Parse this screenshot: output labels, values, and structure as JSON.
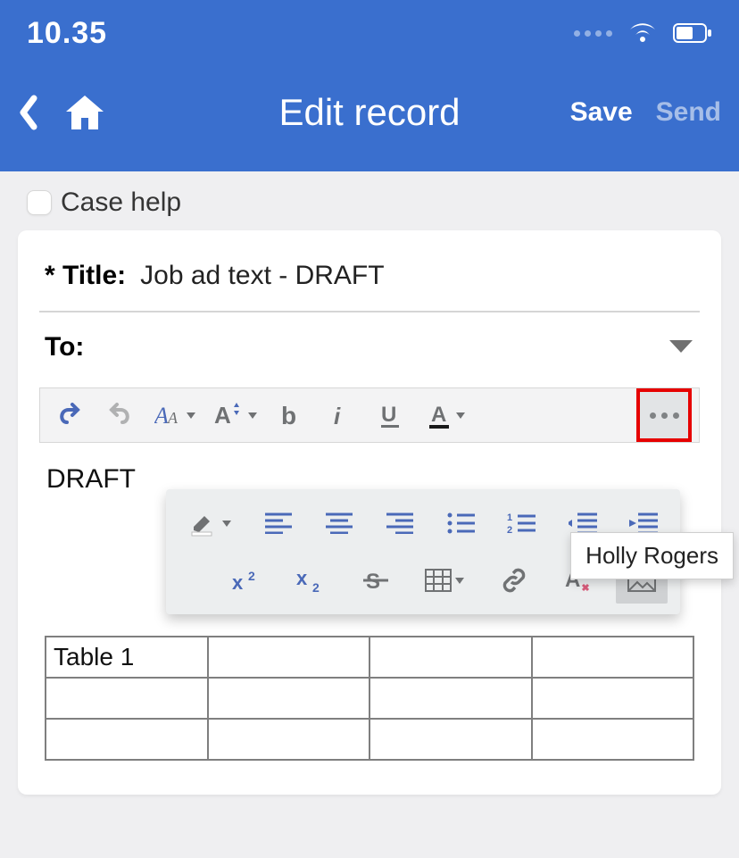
{
  "status": {
    "time": "10.35"
  },
  "header": {
    "title": "Edit record",
    "save_label": "Save",
    "send_label": "Send"
  },
  "subheader": {
    "case_help_label": "Case help"
  },
  "fields": {
    "title_label": "* Title:",
    "title_value": "Job ad text - DRAFT",
    "to_label": "To:"
  },
  "editor": {
    "body_text": "DRAFT"
  },
  "tooltip": {
    "text": "Holly Rogers"
  },
  "table": {
    "rows": [
      [
        "Table 1",
        "",
        "",
        ""
      ],
      [
        "",
        "",
        "",
        ""
      ],
      [
        "",
        "",
        "",
        ""
      ]
    ]
  }
}
